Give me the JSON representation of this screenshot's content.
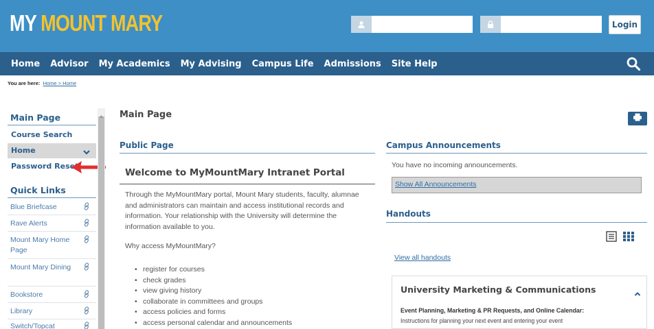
{
  "header": {
    "logo_my": "MY",
    "logo_rest": "MOUNT MARY",
    "username_placeholder": "",
    "password_placeholder": "",
    "login_label": "Login"
  },
  "nav": {
    "items": [
      "Home",
      "Advisor",
      "My Academics",
      "My Advising",
      "Campus Life",
      "Admissions",
      "Site Help"
    ]
  },
  "breadcrumb": {
    "prefix": "You are here:",
    "path": "Home > Home"
  },
  "sidebar": {
    "main_heading": "Main Page",
    "course_search": "Course Search",
    "home": "Home",
    "password_reset": "Password Reset",
    "quick_links_heading": "Quick Links",
    "quick_links": [
      "Blue Briefcase",
      "Rave Alerts",
      "Mount Mary Home Page",
      "Mount Mary Dining",
      "Bookstore",
      "Library",
      "Switch/Topcat"
    ]
  },
  "main": {
    "title": "Main Page",
    "public_page": {
      "heading": "Public Page",
      "welcome": "Welcome to MyMountMary Intranet Portal",
      "paragraph": "Through the MyMountMary portal, Mount Mary students, faculty, alumnae and administrators can maintain and access institutional records and information. Your relationship with the University will determine the information available to you.",
      "why": "Why access MyMountMary?",
      "bullets": [
        "register for courses",
        "check grades",
        "view giving history",
        "collaborate in committees and groups",
        "access policies and forms",
        "access personal calendar and announcements"
      ]
    },
    "announcements": {
      "heading": "Campus Announcements",
      "empty": "You have no incoming announcements.",
      "show_all": "Show All Announcements"
    },
    "handouts": {
      "heading": "Handouts",
      "view_all": "View all handouts",
      "card_title": "University Marketing & Communications",
      "card_subtitle": "Event Planning, Marketing & PR Requests, and Online Calendar:",
      "card_desc": "Instructions for planning your next event and entering your event"
    }
  },
  "colors": {
    "header_blue": "#3d8fc6",
    "nav_blue": "#2b5f8c",
    "logo_gold": "#f2c230",
    "arrow_red": "#e0312f"
  }
}
